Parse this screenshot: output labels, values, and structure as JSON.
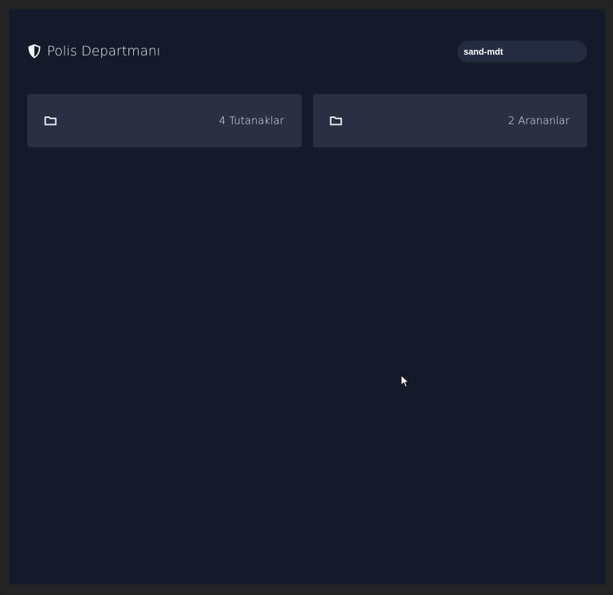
{
  "header": {
    "title": "Polis Departmanı",
    "icon": "shield-icon"
  },
  "search": {
    "value": "sand-mdt"
  },
  "cards": [
    {
      "icon": "folder-icon",
      "label": "4 Tutanaklar"
    },
    {
      "icon": "folder-icon",
      "label": "2 Arananlar"
    }
  ],
  "colors": {
    "background": "#151a2b",
    "card": "#2a3042",
    "search": "#262c40",
    "text": "#eef0f6"
  }
}
